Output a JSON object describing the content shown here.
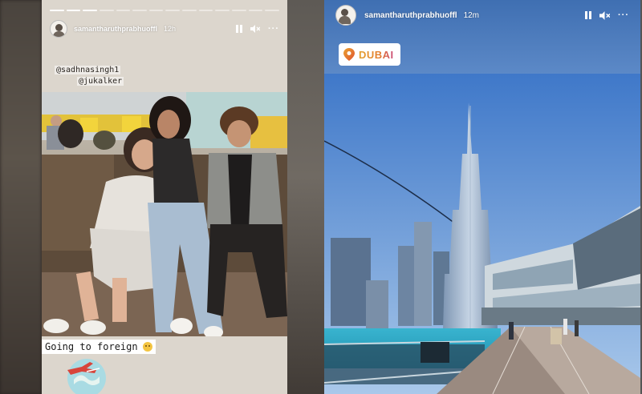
{
  "story1": {
    "username": "samantharuthprabhuoffl",
    "time": "12h",
    "progress_segments": 14,
    "progress_done": 3,
    "mentions": [
      "@sadhnasingh1",
      "@jukalker"
    ],
    "caption": "Going to foreign",
    "icons": [
      "pause-icon",
      "mute-icon",
      "more-icon"
    ]
  },
  "story2": {
    "username": "samantharuthprabhuoffl",
    "time": "12m",
    "location": "DUBAI",
    "icons": [
      "pause-icon",
      "mute-icon",
      "more-icon",
      "location-pin-icon"
    ]
  },
  "colors": {
    "sky": "#6e9bd6",
    "water": "#2aa6c4",
    "location_gradient": [
      "#e4a233",
      "#c94a7f"
    ]
  }
}
